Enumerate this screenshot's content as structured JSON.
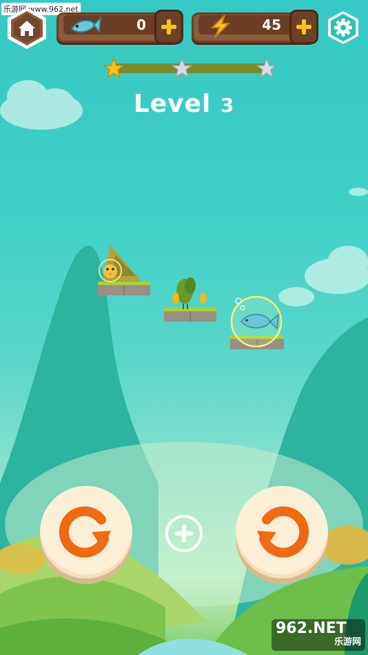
{
  "watermark_top": "乐游网 www.962.net",
  "hud": {
    "fish_count": "0",
    "energy_count": "45"
  },
  "progress": {
    "stars_earned": 1,
    "stars_total": 3
  },
  "level": {
    "label": "Level",
    "number": "3"
  },
  "watermark_bottom": {
    "big": "962.NET",
    "small": "乐游网"
  },
  "colors": {
    "sky": "#3fd0c6",
    "wood": "#8a5a3a",
    "accent_orange": "#ef6a12",
    "star_gold": "#f7c21c"
  }
}
